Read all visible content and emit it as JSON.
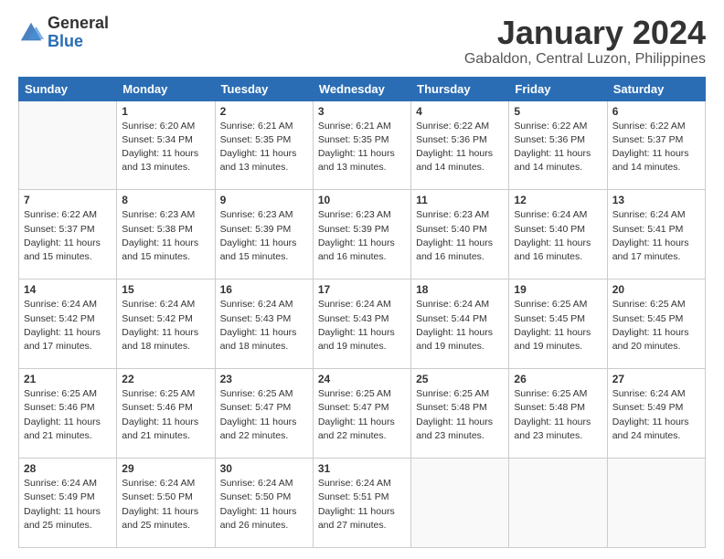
{
  "logo": {
    "general": "General",
    "blue": "Blue"
  },
  "header": {
    "month": "January 2024",
    "location": "Gabaldon, Central Luzon, Philippines"
  },
  "weekdays": [
    "Sunday",
    "Monday",
    "Tuesday",
    "Wednesday",
    "Thursday",
    "Friday",
    "Saturday"
  ],
  "weeks": [
    [
      {
        "day": "",
        "info": ""
      },
      {
        "day": "1",
        "info": "Sunrise: 6:20 AM\nSunset: 5:34 PM\nDaylight: 11 hours\nand 13 minutes."
      },
      {
        "day": "2",
        "info": "Sunrise: 6:21 AM\nSunset: 5:35 PM\nDaylight: 11 hours\nand 13 minutes."
      },
      {
        "day": "3",
        "info": "Sunrise: 6:21 AM\nSunset: 5:35 PM\nDaylight: 11 hours\nand 13 minutes."
      },
      {
        "day": "4",
        "info": "Sunrise: 6:22 AM\nSunset: 5:36 PM\nDaylight: 11 hours\nand 14 minutes."
      },
      {
        "day": "5",
        "info": "Sunrise: 6:22 AM\nSunset: 5:36 PM\nDaylight: 11 hours\nand 14 minutes."
      },
      {
        "day": "6",
        "info": "Sunrise: 6:22 AM\nSunset: 5:37 PM\nDaylight: 11 hours\nand 14 minutes."
      }
    ],
    [
      {
        "day": "7",
        "info": "Sunrise: 6:22 AM\nSunset: 5:37 PM\nDaylight: 11 hours\nand 15 minutes."
      },
      {
        "day": "8",
        "info": "Sunrise: 6:23 AM\nSunset: 5:38 PM\nDaylight: 11 hours\nand 15 minutes."
      },
      {
        "day": "9",
        "info": "Sunrise: 6:23 AM\nSunset: 5:39 PM\nDaylight: 11 hours\nand 15 minutes."
      },
      {
        "day": "10",
        "info": "Sunrise: 6:23 AM\nSunset: 5:39 PM\nDaylight: 11 hours\nand 16 minutes."
      },
      {
        "day": "11",
        "info": "Sunrise: 6:23 AM\nSunset: 5:40 PM\nDaylight: 11 hours\nand 16 minutes."
      },
      {
        "day": "12",
        "info": "Sunrise: 6:24 AM\nSunset: 5:40 PM\nDaylight: 11 hours\nand 16 minutes."
      },
      {
        "day": "13",
        "info": "Sunrise: 6:24 AM\nSunset: 5:41 PM\nDaylight: 11 hours\nand 17 minutes."
      }
    ],
    [
      {
        "day": "14",
        "info": "Sunrise: 6:24 AM\nSunset: 5:42 PM\nDaylight: 11 hours\nand 17 minutes."
      },
      {
        "day": "15",
        "info": "Sunrise: 6:24 AM\nSunset: 5:42 PM\nDaylight: 11 hours\nand 18 minutes."
      },
      {
        "day": "16",
        "info": "Sunrise: 6:24 AM\nSunset: 5:43 PM\nDaylight: 11 hours\nand 18 minutes."
      },
      {
        "day": "17",
        "info": "Sunrise: 6:24 AM\nSunset: 5:43 PM\nDaylight: 11 hours\nand 19 minutes."
      },
      {
        "day": "18",
        "info": "Sunrise: 6:24 AM\nSunset: 5:44 PM\nDaylight: 11 hours\nand 19 minutes."
      },
      {
        "day": "19",
        "info": "Sunrise: 6:25 AM\nSunset: 5:45 PM\nDaylight: 11 hours\nand 19 minutes."
      },
      {
        "day": "20",
        "info": "Sunrise: 6:25 AM\nSunset: 5:45 PM\nDaylight: 11 hours\nand 20 minutes."
      }
    ],
    [
      {
        "day": "21",
        "info": "Sunrise: 6:25 AM\nSunset: 5:46 PM\nDaylight: 11 hours\nand 21 minutes."
      },
      {
        "day": "22",
        "info": "Sunrise: 6:25 AM\nSunset: 5:46 PM\nDaylight: 11 hours\nand 21 minutes."
      },
      {
        "day": "23",
        "info": "Sunrise: 6:25 AM\nSunset: 5:47 PM\nDaylight: 11 hours\nand 22 minutes."
      },
      {
        "day": "24",
        "info": "Sunrise: 6:25 AM\nSunset: 5:47 PM\nDaylight: 11 hours\nand 22 minutes."
      },
      {
        "day": "25",
        "info": "Sunrise: 6:25 AM\nSunset: 5:48 PM\nDaylight: 11 hours\nand 23 minutes."
      },
      {
        "day": "26",
        "info": "Sunrise: 6:25 AM\nSunset: 5:48 PM\nDaylight: 11 hours\nand 23 minutes."
      },
      {
        "day": "27",
        "info": "Sunrise: 6:24 AM\nSunset: 5:49 PM\nDaylight: 11 hours\nand 24 minutes."
      }
    ],
    [
      {
        "day": "28",
        "info": "Sunrise: 6:24 AM\nSunset: 5:49 PM\nDaylight: 11 hours\nand 25 minutes."
      },
      {
        "day": "29",
        "info": "Sunrise: 6:24 AM\nSunset: 5:50 PM\nDaylight: 11 hours\nand 25 minutes."
      },
      {
        "day": "30",
        "info": "Sunrise: 6:24 AM\nSunset: 5:50 PM\nDaylight: 11 hours\nand 26 minutes."
      },
      {
        "day": "31",
        "info": "Sunrise: 6:24 AM\nSunset: 5:51 PM\nDaylight: 11 hours\nand 27 minutes."
      },
      {
        "day": "",
        "info": ""
      },
      {
        "day": "",
        "info": ""
      },
      {
        "day": "",
        "info": ""
      }
    ]
  ]
}
